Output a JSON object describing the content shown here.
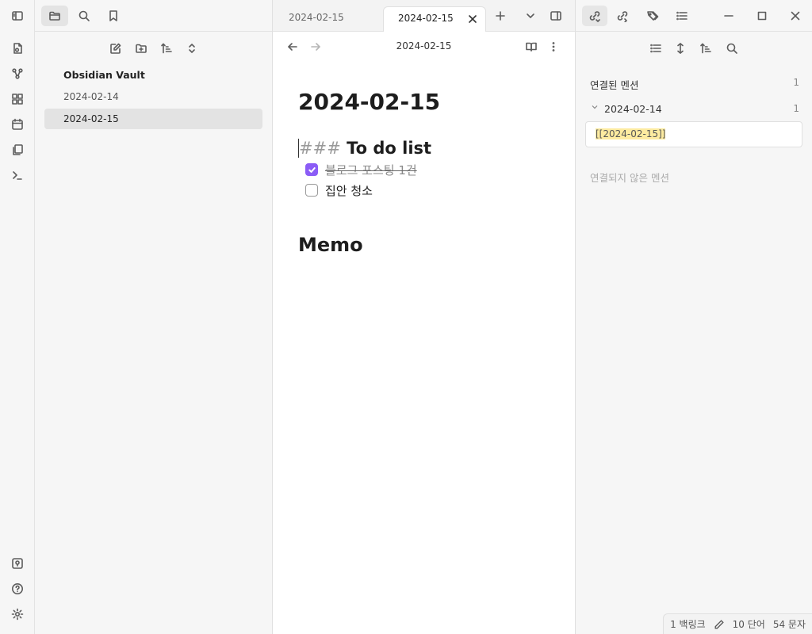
{
  "sidebar": {
    "vault_name": "Obsidian Vault",
    "files": [
      "2024-02-14",
      "2024-02-15"
    ],
    "active_file": "2024-02-15"
  },
  "tabs": [
    {
      "label": "2024-02-15",
      "active": false
    },
    {
      "label": "2024-02-15",
      "active": true
    }
  ],
  "view": {
    "header_title": "2024-02-15"
  },
  "note": {
    "title": "2024-02-15",
    "heading_markup": "###",
    "heading_text": "To do list",
    "tasks": [
      {
        "text": "블로그 포스팅 1건",
        "checked": true
      },
      {
        "text": "집안 청소",
        "checked": false
      }
    ],
    "memo_heading": "Memo"
  },
  "backlinks": {
    "linked_label": "연결된 멘션",
    "linked_count": "1",
    "file": "2024-02-14",
    "file_count": "1",
    "match_text": "[[2024-02-15]]",
    "unlinked_label": "연결되지 않은 멘션"
  },
  "status": {
    "backlinks": "1 백링크",
    "words": "10 단어",
    "chars": "54 문자"
  },
  "colors": {
    "accent": "#8b5cf6",
    "highlight": "#fdeba0"
  }
}
